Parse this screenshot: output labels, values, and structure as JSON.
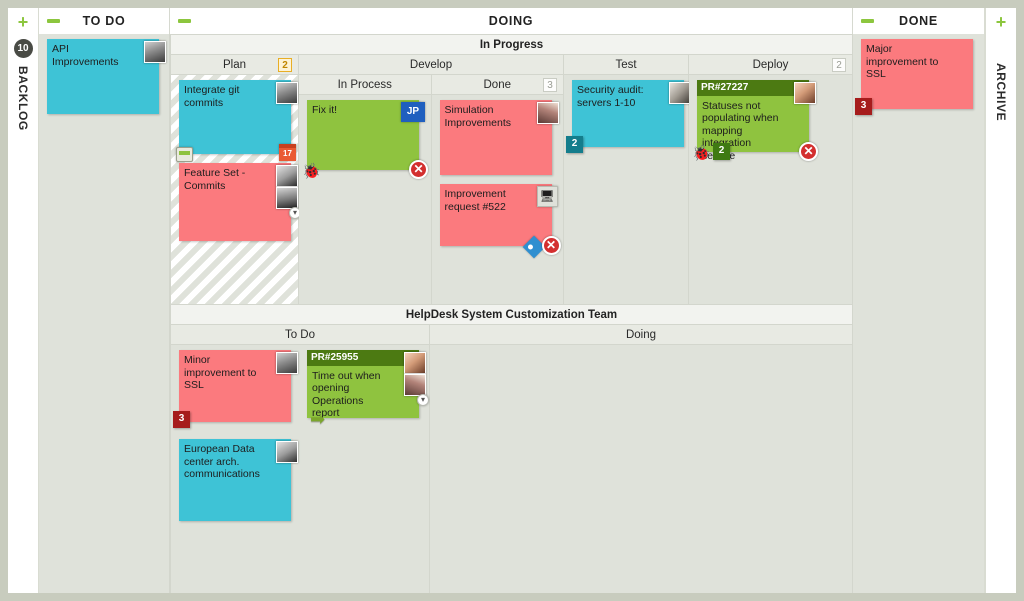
{
  "rails": {
    "left": {
      "plus": "+",
      "count": "10",
      "label": "BACKLOG"
    },
    "right": {
      "plus": "+",
      "label": "ARCHIVE"
    }
  },
  "top_lanes": [
    {
      "title": "TO DO",
      "collapse": "-"
    },
    {
      "title": "DOING",
      "collapse": "-"
    },
    {
      "title": "DONE",
      "collapse": "-"
    }
  ],
  "swimlanes": [
    {
      "title": "In Progress",
      "columns": [
        {
          "name": "Plan",
          "wip": "2",
          "wip_warn": true
        },
        {
          "name": "Develop",
          "wip": "",
          "subcolumns": [
            {
              "name": "In Process",
              "wip": ""
            },
            {
              "name": "Done",
              "wip": "3"
            }
          ]
        },
        {
          "name": "Test",
          "wip": ""
        },
        {
          "name": "Deploy",
          "wip": "2"
        }
      ]
    },
    {
      "title": "HelpDesk System Customization Team",
      "columns": [
        {
          "name": "To Do",
          "wip": ""
        },
        {
          "name": "Doing",
          "wip": ""
        }
      ]
    }
  ],
  "cards": {
    "todo_backlog": [
      {
        "title": "API Improvements",
        "color": "cyan",
        "avatar": "face-a"
      }
    ],
    "plan": [
      {
        "title": "Integrate git commits",
        "color": "cyan",
        "avatar": "face-a",
        "calendar": "17",
        "has_note": true
      },
      {
        "title": "Feature Set - Commits",
        "color": "red",
        "avatar": "face-c",
        "avatar2": "face-e",
        "avatar_more": "▾"
      }
    ],
    "develop_in_process": [
      {
        "title": "Fix it!",
        "color": "green",
        "initials": "JP",
        "bug": true,
        "blocked": true
      }
    ],
    "develop_done": [
      {
        "title": "Simulation Improvements",
        "color": "red",
        "avatar": "face-b"
      },
      {
        "title": "Improvement request #522",
        "color": "red",
        "icon": "monitor-icon",
        "tag": true,
        "blocked": true
      }
    ],
    "test": [
      {
        "title": "Security audit: servers 1-10",
        "color": "cyan",
        "avatar": "face-f",
        "badge": "2",
        "badge_style": "teal"
      }
    ],
    "deploy": [
      {
        "header": "PR#27227",
        "title": "Statuses not populating when mapping integration service",
        "color": "green",
        "avatar": "face-d",
        "bug": true,
        "badge": "2",
        "badge_style": "green",
        "blocked": true
      }
    ],
    "done": [
      {
        "title": "Major improvement to SSL",
        "color": "red",
        "badge": "3",
        "badge_style": "dark-red"
      }
    ],
    "helpdesk_todo": [
      {
        "title": "Minor improvement to SSL",
        "color": "red",
        "avatar": "face-a",
        "badge": "3",
        "badge_style": "dark-red"
      },
      {
        "title": "European Data center arch. communications",
        "color": "cyan",
        "avatar": "face-c"
      }
    ],
    "helpdesk_todo_second": [
      {
        "header": "PR#25955",
        "title": "Time out when opening Operations report",
        "color": "green",
        "avatar": "face-d",
        "avatar2": "face-b",
        "avatar_more": "▾",
        "arrow": true
      }
    ],
    "helpdesk_doing": []
  },
  "icons": {
    "blocker": "✕",
    "bug": "🐞",
    "monitor": "🖥",
    "arrow": "➡"
  },
  "colors": {
    "cyan": "#3ec3d6",
    "red": "#fb7a7e",
    "green": "#8fc33f",
    "green_header": "#4c7a12",
    "accent_plus": "#8cc63e",
    "board_bg": "#dfe2da",
    "page_bg": "#c8ccbe"
  }
}
